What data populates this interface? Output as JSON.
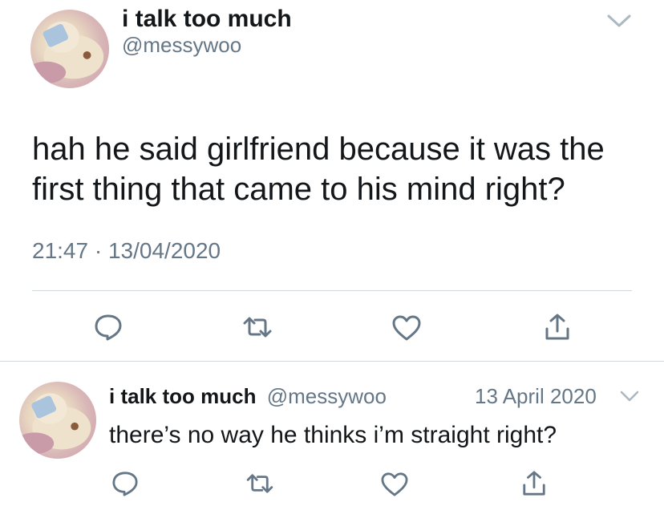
{
  "tweet_main": {
    "display_name": "i talk too much",
    "handle": "@messywoo",
    "text_line1": "hah he said girlfriend because it was the",
    "text_line2": "first thing that came to his mind right?",
    "time": "21:47",
    "separator": "·",
    "date": "13/04/2020"
  },
  "tweet_reply": {
    "display_name": "i talk too much",
    "handle": "@messywoo",
    "date": "13 April 2020",
    "text": "there’s no way he thinks i’m straight right?"
  },
  "colors": {
    "text": "#14171a",
    "secondary": "#657786",
    "icon": "#657786",
    "divider": "#cfd9de"
  },
  "icons": {
    "reply": "speech-bubble-icon",
    "retweet": "retweet-icon",
    "like": "heart-icon",
    "share": "share-icon",
    "menu": "chevron-down-icon"
  }
}
